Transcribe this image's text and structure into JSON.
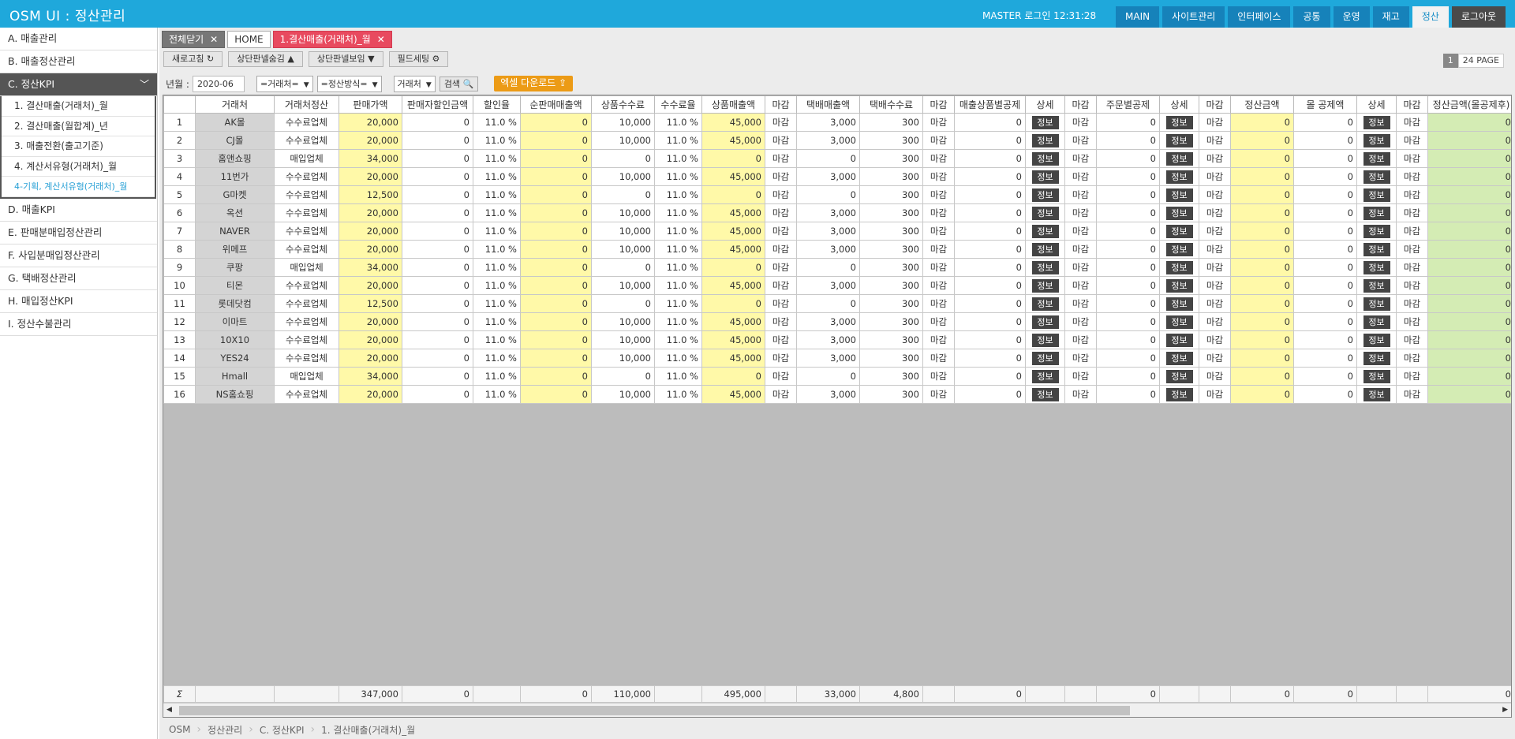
{
  "app": {
    "title": "OSM UI : 정산관리",
    "login": "MASTER 로그인 12:31:28"
  },
  "topnav": [
    "MAIN",
    "사이트관리",
    "인터페이스",
    "공통",
    "운영",
    "재고",
    "정산",
    "로그아웃"
  ],
  "sidebar": {
    "items_top": [
      "A. 매출관리",
      "B. 매출정산관리"
    ],
    "open_item": "C. 정산KPI",
    "subitems": [
      "1. 결산매출(거래처)_월",
      "2. 결산매출(월합계)_년",
      "3. 매출전환(출고기준)",
      "4. 계산서유형(거래처)_월",
      "4-기획, 계산서유형(거래처)_월"
    ],
    "items_bottom": [
      "D. 매출KPI",
      "E. 판매분매입정산관리",
      "F. 사입분매입정산관리",
      "G. 택배정산관리",
      "H. 매입정산KPI",
      "I. 정산수불관리"
    ]
  },
  "tabs": {
    "close_all": "전체닫기",
    "home": "HOME",
    "active": "1.결산매출(거래처)_월"
  },
  "toolbar": {
    "refresh": "새로고침 ↻",
    "hide_top": "상단판넬숨김 ▲",
    "show_top": "상단판넬보임 ▼",
    "field_setting": "필드세팅 ⚙"
  },
  "pager": {
    "current": "1",
    "total": "24 PAGE"
  },
  "filters": {
    "ym_label": "년월 :",
    "ym_value": "2020-06",
    "vendor_select": "=거래처=",
    "method_select": "=정산방식=",
    "type_select": "거래처",
    "search": "검색",
    "excel": "엑셀 다운로드"
  },
  "columns": [
    "",
    "거래처",
    "거래처정산",
    "판매가액",
    "판매자할인금액",
    "할인율",
    "순판매매출액",
    "상품수수료",
    "수수료율",
    "상품매출액",
    "마감",
    "택배매출액",
    "택배수수료",
    "마감",
    "매출상품별공제",
    "상세",
    "마감",
    "주문별공제",
    "상세",
    "마감",
    "정산금액",
    "몰 공제액",
    "상세",
    "마감",
    "정산금액(몰공제후)"
  ],
  "labels": {
    "info": "정보",
    "closed": "마감"
  },
  "rows": [
    {
      "no": "1",
      "vendor": "AK몰",
      "type": "수수료업체",
      "sale": "20,000",
      "disc": "0",
      "rate": "11.0 %",
      "net": "0",
      "fee": "10,000",
      "feerate": "11.0 %",
      "goods": "45,000",
      "dlv": "3,000",
      "dlvfee": "300",
      "ded1": "0",
      "ded2": "0",
      "settle": "0",
      "mall": "0",
      "final": "0"
    },
    {
      "no": "2",
      "vendor": "CJ몰",
      "type": "수수료업체",
      "sale": "20,000",
      "disc": "0",
      "rate": "11.0 %",
      "net": "0",
      "fee": "10,000",
      "feerate": "11.0 %",
      "goods": "45,000",
      "dlv": "3,000",
      "dlvfee": "300",
      "ded1": "0",
      "ded2": "0",
      "settle": "0",
      "mall": "0",
      "final": "0"
    },
    {
      "no": "3",
      "vendor": "홈앤쇼핑",
      "type": "매입업체",
      "sale": "34,000",
      "disc": "0",
      "rate": "11.0 %",
      "net": "0",
      "fee": "0",
      "feerate": "11.0 %",
      "goods": "0",
      "dlv": "0",
      "dlvfee": "300",
      "ded1": "0",
      "ded2": "0",
      "settle": "0",
      "mall": "0",
      "final": "0"
    },
    {
      "no": "4",
      "vendor": "11번가",
      "type": "수수료업체",
      "sale": "20,000",
      "disc": "0",
      "rate": "11.0 %",
      "net": "0",
      "fee": "10,000",
      "feerate": "11.0 %",
      "goods": "45,000",
      "dlv": "3,000",
      "dlvfee": "300",
      "ded1": "0",
      "ded2": "0",
      "settle": "0",
      "mall": "0",
      "final": "0"
    },
    {
      "no": "5",
      "vendor": "G마켓",
      "type": "수수료업체",
      "sale": "12,500",
      "disc": "0",
      "rate": "11.0 %",
      "net": "0",
      "fee": "0",
      "feerate": "11.0 %",
      "goods": "0",
      "dlv": "0",
      "dlvfee": "300",
      "ded1": "0",
      "ded2": "0",
      "settle": "0",
      "mall": "0",
      "final": "0"
    },
    {
      "no": "6",
      "vendor": "옥션",
      "type": "수수료업체",
      "sale": "20,000",
      "disc": "0",
      "rate": "11.0 %",
      "net": "0",
      "fee": "10,000",
      "feerate": "11.0 %",
      "goods": "45,000",
      "dlv": "3,000",
      "dlvfee": "300",
      "ded1": "0",
      "ded2": "0",
      "settle": "0",
      "mall": "0",
      "final": "0"
    },
    {
      "no": "7",
      "vendor": "NAVER",
      "type": "수수료업체",
      "sale": "20,000",
      "disc": "0",
      "rate": "11.0 %",
      "net": "0",
      "fee": "10,000",
      "feerate": "11.0 %",
      "goods": "45,000",
      "dlv": "3,000",
      "dlvfee": "300",
      "ded1": "0",
      "ded2": "0",
      "settle": "0",
      "mall": "0",
      "final": "0"
    },
    {
      "no": "8",
      "vendor": "위메프",
      "type": "수수료업체",
      "sale": "20,000",
      "disc": "0",
      "rate": "11.0 %",
      "net": "0",
      "fee": "10,000",
      "feerate": "11.0 %",
      "goods": "45,000",
      "dlv": "3,000",
      "dlvfee": "300",
      "ded1": "0",
      "ded2": "0",
      "settle": "0",
      "mall": "0",
      "final": "0"
    },
    {
      "no": "9",
      "vendor": "쿠팡",
      "type": "매입업체",
      "sale": "34,000",
      "disc": "0",
      "rate": "11.0 %",
      "net": "0",
      "fee": "0",
      "feerate": "11.0 %",
      "goods": "0",
      "dlv": "0",
      "dlvfee": "300",
      "ded1": "0",
      "ded2": "0",
      "settle": "0",
      "mall": "0",
      "final": "0"
    },
    {
      "no": "10",
      "vendor": "티몬",
      "type": "수수료업체",
      "sale": "20,000",
      "disc": "0",
      "rate": "11.0 %",
      "net": "0",
      "fee": "10,000",
      "feerate": "11.0 %",
      "goods": "45,000",
      "dlv": "3,000",
      "dlvfee": "300",
      "ded1": "0",
      "ded2": "0",
      "settle": "0",
      "mall": "0",
      "final": "0"
    },
    {
      "no": "11",
      "vendor": "롯데닷컴",
      "type": "수수료업체",
      "sale": "12,500",
      "disc": "0",
      "rate": "11.0 %",
      "net": "0",
      "fee": "0",
      "feerate": "11.0 %",
      "goods": "0",
      "dlv": "0",
      "dlvfee": "300",
      "ded1": "0",
      "ded2": "0",
      "settle": "0",
      "mall": "0",
      "final": "0"
    },
    {
      "no": "12",
      "vendor": "이마트",
      "type": "수수료업체",
      "sale": "20,000",
      "disc": "0",
      "rate": "11.0 %",
      "net": "0",
      "fee": "10,000",
      "feerate": "11.0 %",
      "goods": "45,000",
      "dlv": "3,000",
      "dlvfee": "300",
      "ded1": "0",
      "ded2": "0",
      "settle": "0",
      "mall": "0",
      "final": "0"
    },
    {
      "no": "13",
      "vendor": "10X10",
      "type": "수수료업체",
      "sale": "20,000",
      "disc": "0",
      "rate": "11.0 %",
      "net": "0",
      "fee": "10,000",
      "feerate": "11.0 %",
      "goods": "45,000",
      "dlv": "3,000",
      "dlvfee": "300",
      "ded1": "0",
      "ded2": "0",
      "settle": "0",
      "mall": "0",
      "final": "0"
    },
    {
      "no": "14",
      "vendor": "YES24",
      "type": "수수료업체",
      "sale": "20,000",
      "disc": "0",
      "rate": "11.0 %",
      "net": "0",
      "fee": "10,000",
      "feerate": "11.0 %",
      "goods": "45,000",
      "dlv": "3,000",
      "dlvfee": "300",
      "ded1": "0",
      "ded2": "0",
      "settle": "0",
      "mall": "0",
      "final": "0"
    },
    {
      "no": "15",
      "vendor": "Hmall",
      "type": "매입업체",
      "sale": "34,000",
      "disc": "0",
      "rate": "11.0 %",
      "net": "0",
      "fee": "0",
      "feerate": "11.0 %",
      "goods": "0",
      "dlv": "0",
      "dlvfee": "300",
      "ded1": "0",
      "ded2": "0",
      "settle": "0",
      "mall": "0",
      "final": "0"
    },
    {
      "no": "16",
      "vendor": "NS홈쇼핑",
      "type": "수수료업체",
      "sale": "20,000",
      "disc": "0",
      "rate": "11.0 %",
      "net": "0",
      "fee": "10,000",
      "feerate": "11.0 %",
      "goods": "45,000",
      "dlv": "3,000",
      "dlvfee": "300",
      "ded1": "0",
      "ded2": "0",
      "settle": "0",
      "mall": "0",
      "final": "0"
    }
  ],
  "totals": {
    "sigma": "Σ",
    "sale": "347,000",
    "disc": "0",
    "net": "0",
    "fee": "110,000",
    "goods": "495,000",
    "dlv": "33,000",
    "dlvfee": "4,800",
    "ded1": "0",
    "ded2": "0",
    "settle": "0",
    "mall": "0",
    "final": "0"
  },
  "breadcrumb": [
    "OSM",
    "정산관리",
    "C. 정산KPI",
    "1. 결산매출(거래처)_월"
  ],
  "colors": {
    "header": "#1fa8db",
    "yellow_cell": "#fff9a8",
    "green_cell": "#d4ecb4",
    "active_tab": "#e84a5f",
    "excel": "#ec9b16"
  }
}
